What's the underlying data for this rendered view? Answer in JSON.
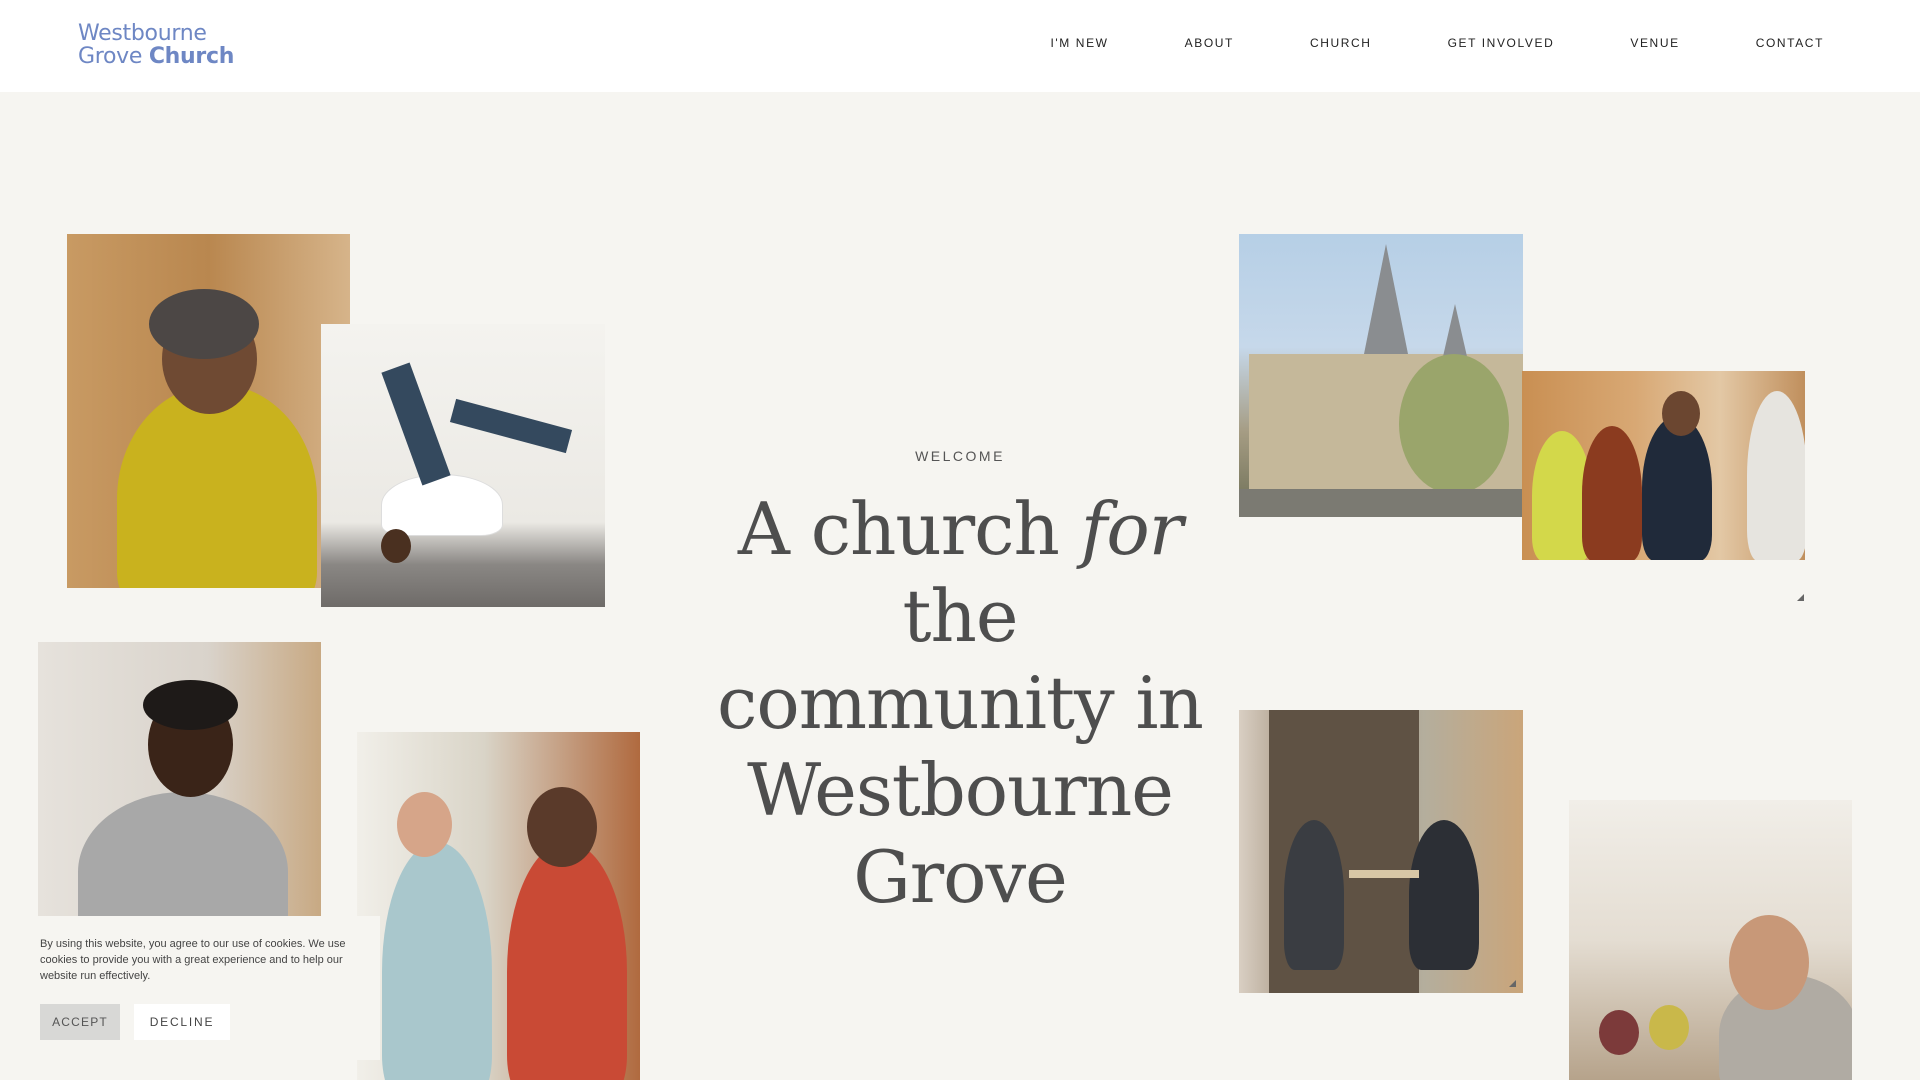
{
  "header": {
    "logo": {
      "line1": "Westbourne",
      "line2_a": "Grove",
      "line2_b": "Church"
    },
    "nav": [
      "I'M NEW",
      "ABOUT",
      "CHURCH",
      "GET INVOLVED",
      "VENUE",
      "CONTACT"
    ]
  },
  "hero": {
    "eyebrow": "WELCOME",
    "title_a": "A church",
    "title_em": "for",
    "title_b": "the",
    "title_c": "community in",
    "title_d": "Westbourne",
    "title_e": "Grove"
  },
  "cookie_banner": {
    "text": "By using this website, you agree to our use of cookies. We use cookies to provide you with a great experience and to help our website run effectively.",
    "accept_label": "ACCEPT",
    "decline_label": "DECLINE"
  },
  "colors": {
    "background": "#f6f5f1",
    "logo_blue": "#6e87c4",
    "title_grey": "#4e4e4e"
  }
}
